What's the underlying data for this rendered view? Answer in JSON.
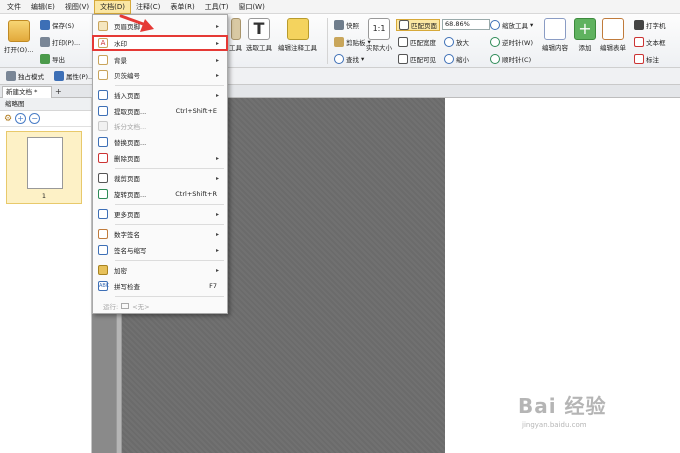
{
  "menubar": {
    "items": [
      "文件",
      "编辑(E)",
      "视图(V)",
      "文档(D)",
      "注释(C)",
      "表单(R)",
      "工具(T)",
      "窗口(W)"
    ]
  },
  "ribbon": {
    "open": "打开(O)...",
    "save": "保存(S)",
    "print": "打印(P)...",
    "export": "导出",
    "attributes": "属性(P)...",
    "reading_mode": "独占模式",
    "tool_frag": "工具",
    "select_tool": "选取工具",
    "annotation_tool": "编辑注释工具",
    "snapshot": "快照",
    "clipboard": "剪贴板",
    "find": "查找",
    "actual_size": "实际大小",
    "fit_page": "匹配页面",
    "fit_width": "匹配宽度",
    "fit_visible": "匹配可见",
    "zoom_value": "68.86%",
    "zoom_in": "放大",
    "zoom_out": "缩小",
    "zoom_tool": "缩放工具",
    "rotate_left": "逆时针(W)",
    "rotate_right": "顺时针(C)",
    "edit_content": "编辑内容",
    "add": "添加",
    "edit_form": "编辑表单",
    "typewriter": "打字机",
    "textbox": "文本框",
    "callout": "标注"
  },
  "tabs": {
    "doc": "新建文档 *",
    "add": "+"
  },
  "panel": {
    "title": "缩略图",
    "thumb_number": "1"
  },
  "dropdown": {
    "items": [
      {
        "label": "页眉页脚",
        "arrow": "▸"
      },
      {
        "label": "水印",
        "arrow": "▸"
      },
      {
        "label": "背景",
        "arrow": "▸"
      },
      {
        "label": "贝茨编号",
        "arrow": "▸"
      },
      {
        "label": "插入页面",
        "arrow": "▸"
      },
      {
        "label": "提取页面...",
        "shortcut": "Ctrl+Shift+E"
      },
      {
        "label": "拆分文档..."
      },
      {
        "label": "替换页面..."
      },
      {
        "label": "删除页面",
        "arrow": "▸"
      },
      {
        "label": "裁剪页面",
        "arrow": "▸"
      },
      {
        "label": "旋转页面...",
        "shortcut": "Ctrl+Shift+R"
      },
      {
        "label": "更多页面",
        "arrow": "▸"
      },
      {
        "label": "数字签名",
        "arrow": "▸"
      },
      {
        "label": "签名与缩写",
        "arrow": "▸"
      },
      {
        "label": "加密",
        "arrow": "▸"
      },
      {
        "label": "拼写检查",
        "shortcut": "F7"
      },
      {
        "label": "运行:",
        "value": "<无>"
      }
    ]
  },
  "watermark": {
    "brand": "Bai 经验",
    "url": "jingyan.baidu.com"
  },
  "colors": {
    "highlight": "#e53935",
    "menu_active": "#fbe7a3",
    "accent_blue": "#4a7dc6"
  }
}
